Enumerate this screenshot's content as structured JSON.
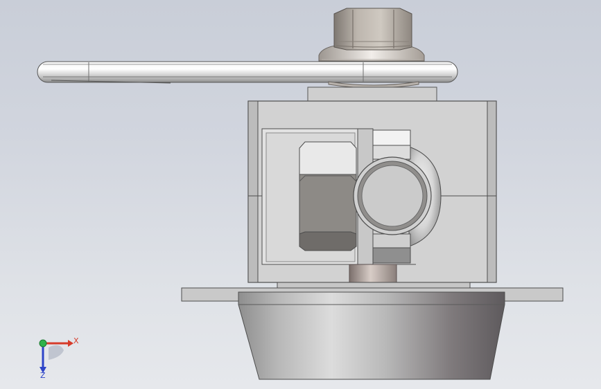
{
  "colors": {
    "background_top": "#c9ced8",
    "background_bottom": "#e6e8ec",
    "axis_x": "#d63b2a",
    "axis_y": "#2fb24a",
    "axis_z": "#2d44c8"
  },
  "triad": {
    "x_label": "X",
    "z_label": "Z"
  }
}
